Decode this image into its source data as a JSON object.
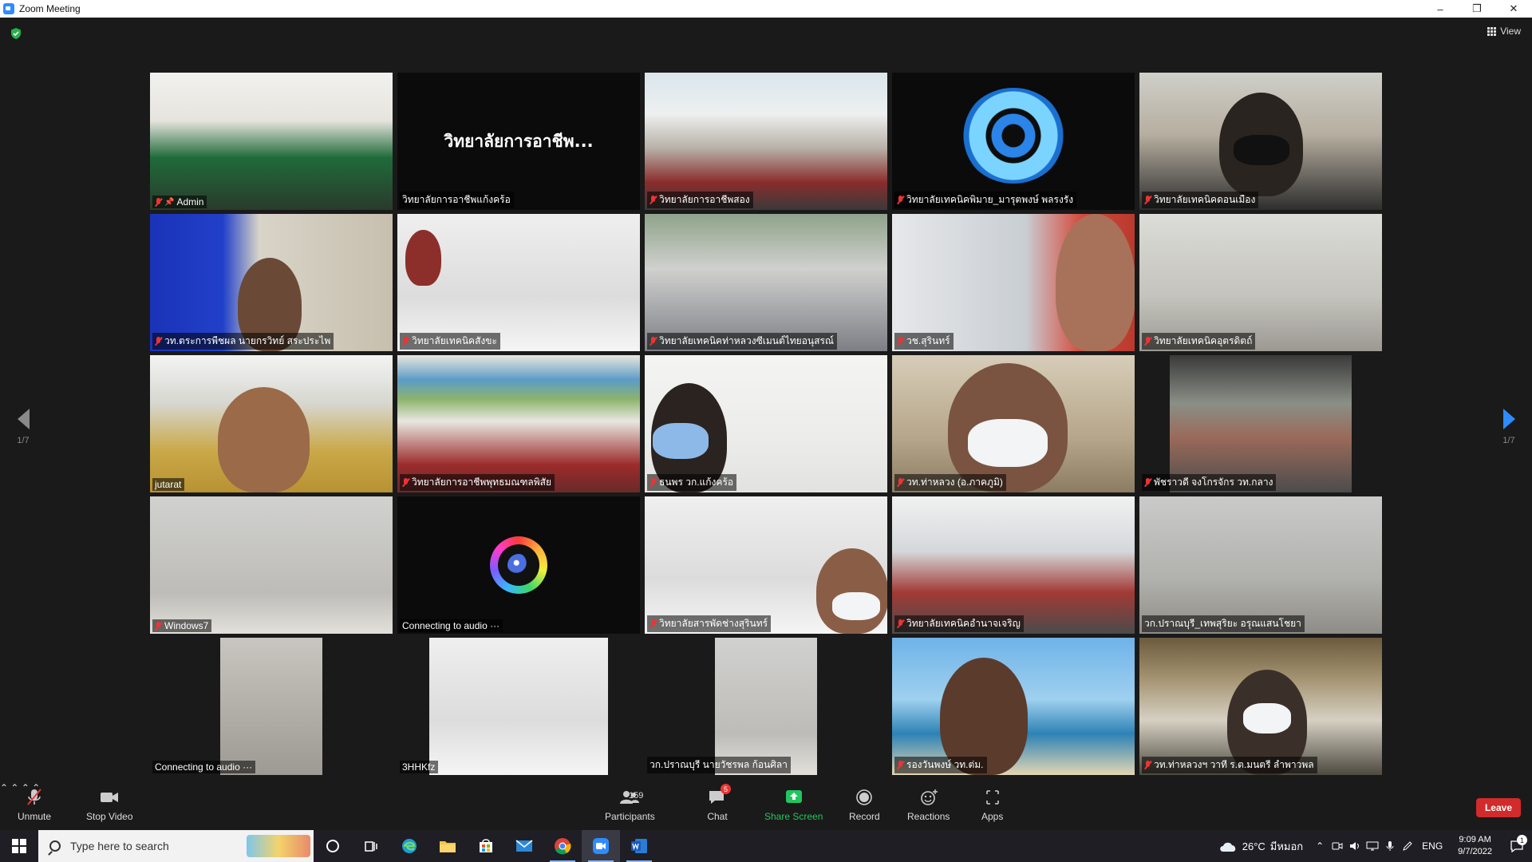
{
  "window": {
    "title": "Zoom Meeting",
    "minimize": "–",
    "restore": "❐",
    "close": "✕"
  },
  "meeting": {
    "view_label": "View",
    "page_indicator_left": "1/7",
    "page_indicator_right": "1/7",
    "tiles": [
      {
        "name": "Admin",
        "muted": true,
        "pinned": true
      },
      {
        "name": "วิทยาลัยการอาชีพแก้งคร้อ",
        "muted": false,
        "center_text": "วิทยาลัยการอาชีพ...",
        "speaking": true
      },
      {
        "name": "วิทยาลัยการอาชีพสอง",
        "muted": true
      },
      {
        "name": "วิทยาลัยเทคนิคพิมาย_มารุตพงษ์ พลรงรัง",
        "muted": true
      },
      {
        "name": "วิทยาลัยเทคนิคดอนเมือง",
        "muted": true
      },
      {
        "name": "วท.ตระการพืชผล นายกรวิทย์ สระประไพ",
        "muted": true
      },
      {
        "name": "วิทยาลัยเทคนิคสังขะ",
        "muted": true
      },
      {
        "name": "วิทยาลัยเทคนิคท่าหลวงซีเมนต์ไทยอนุสรณ์",
        "muted": true
      },
      {
        "name": "วช.สุรินทร์",
        "muted": true
      },
      {
        "name": "วิทยาลัยเทคนิคอุตรดิตถ์",
        "muted": true
      },
      {
        "name": "jutarat",
        "muted": false
      },
      {
        "name": "วิทยาลัยการอาชีพพุทธมณฑลพิสัย",
        "muted": true
      },
      {
        "name": "ธนพร วก.แก้งคร้อ",
        "muted": true
      },
      {
        "name": "วท.ท่าหลวง (อ.ภาคภูมิ)",
        "muted": true
      },
      {
        "name": "พัชราวดี จงโกรจักร วท.กลาง",
        "muted": true
      },
      {
        "name": "Windows7",
        "muted": true
      },
      {
        "name": "Connecting to audio ···",
        "muted": false
      },
      {
        "name": "วิทยาลัยสารพัดช่างสุรินทร์",
        "muted": true
      },
      {
        "name": "วิทยาลัยเทคนิคอำนาจเจริญ",
        "muted": true
      },
      {
        "name": "วก.ปราณบุรี_เทพสุริยะ อรุณแสนโชยา",
        "muted": false
      },
      {
        "name": "Connecting to audio ···",
        "muted": false
      },
      {
        "name": "3HHKfz",
        "muted": false
      },
      {
        "name": "วก.ปราณบุรี นายวัชรพล ก้อนศิลา",
        "muted": false
      },
      {
        "name": "รองวันพงษ์ วท.ต่ม.",
        "muted": true
      },
      {
        "name": "วท.ท่าหลวงฯ วาที ร.ต.มนตรี ลำพาวพล",
        "muted": true
      }
    ]
  },
  "toolbar": {
    "unmute": "Unmute",
    "stop_video": "Stop Video",
    "participants": "Participants",
    "participants_count": "159",
    "chat": "Chat",
    "chat_badge": "5",
    "share_screen": "Share Screen",
    "record": "Record",
    "reactions": "Reactions",
    "apps": "Apps",
    "leave": "Leave",
    "share_color": "#22c55e",
    "leave_color": "#d12b2b"
  },
  "taskbar": {
    "search_placeholder": "Type here to search",
    "weather": "26°C",
    "weather_desc": "มีหมอก",
    "language": "ENG",
    "time": "9:09 AM",
    "date": "9/7/2022",
    "notification_count": "1",
    "apps": [
      "cortana-icon",
      "task-view-icon",
      "edge-icon",
      "file-explorer-icon",
      "store-icon",
      "mail-icon",
      "chrome-icon",
      "zoom-icon",
      "word-icon"
    ]
  }
}
